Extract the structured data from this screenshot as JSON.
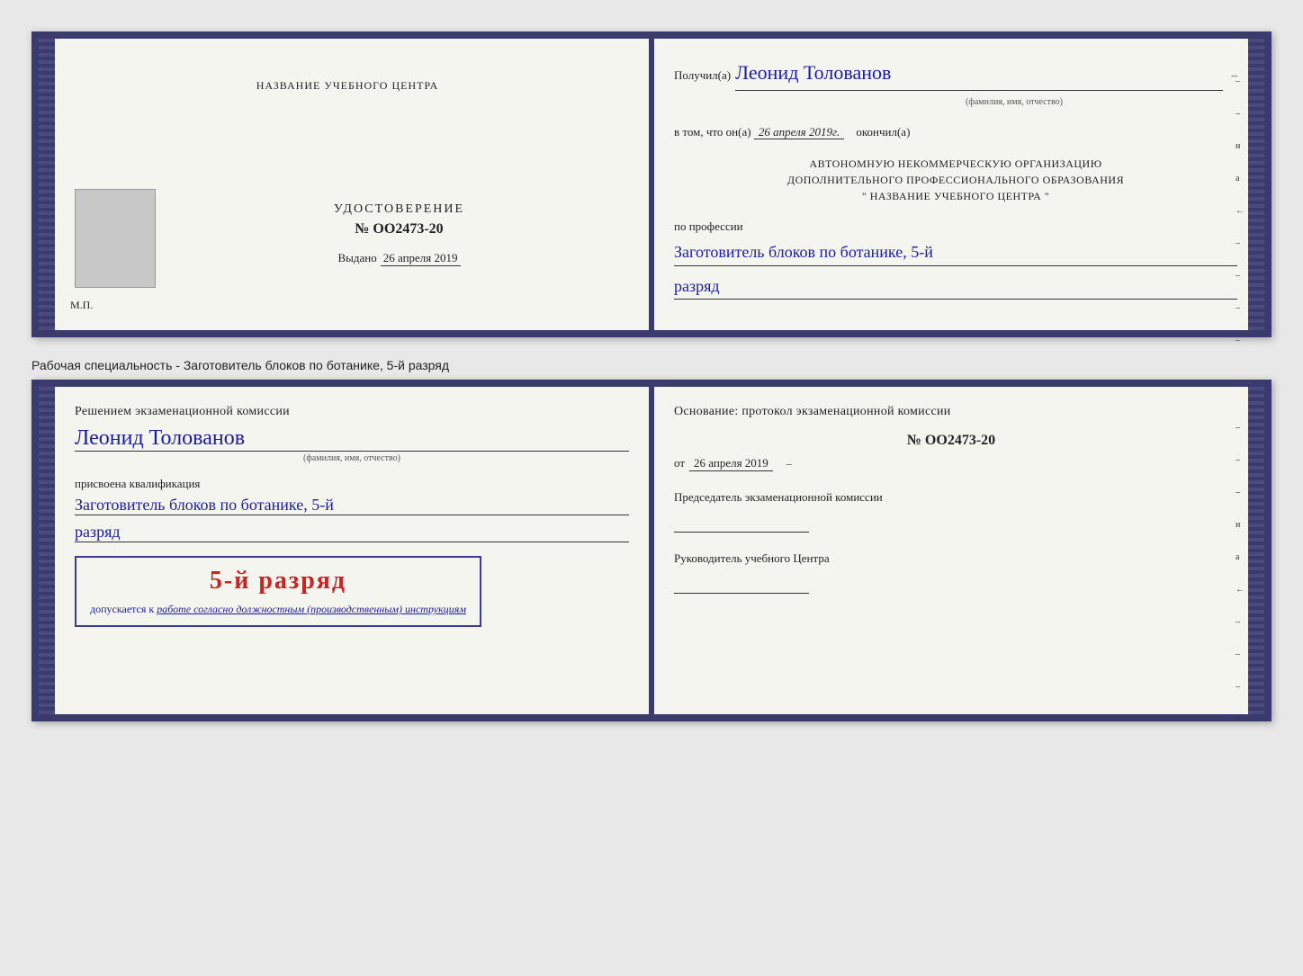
{
  "top_certificate": {
    "left": {
      "org_name": "НАЗВАНИЕ УЧЕБНОГО ЦЕНТРА",
      "cert_type": "УДОСТОВЕРЕНИЕ",
      "cert_number": "№ OO2473-20",
      "issued_label": "Выдано",
      "issued_date": "26 апреля 2019",
      "mp_label": "М.П."
    },
    "right": {
      "received_label": "Получил(а)",
      "recipient_name": "Леонид Толованов",
      "fio_label": "(фамилия, имя, отчество)",
      "date_label": "в том, что он(а)",
      "date_value": "26 апреля 2019г.",
      "finished_label": "окончил(а)",
      "org_block_line1": "АВТОНОМНУЮ НЕКОММЕРЧЕСКУЮ ОРГАНИЗАЦИЮ",
      "org_block_line2": "ДОПОЛНИТЕЛЬНОГО ПРОФЕССИОНАЛЬНОГО ОБРАЗОВАНИЯ",
      "org_block_line3": "\" НАЗВАНИЕ УЧЕБНОГО ЦЕНТРА \"",
      "profession_label": "по профессии",
      "profession_value": "Заготовитель блоков по ботанике, 5-й",
      "rank_value": "разряд",
      "side_marks": [
        "–",
        "–",
        "и",
        "а",
        "←",
        "–",
        "–",
        "–",
        "–"
      ]
    }
  },
  "specialty_label": "Рабочая специальность - Заготовитель блоков по ботанике, 5-й разряд",
  "bottom_certificate": {
    "left": {
      "decision_text": "Решением экзаменационной комиссии",
      "person_name": "Леонид Толованов",
      "fio_label": "(фамилия, имя, отчество)",
      "qualification_label": "присвоена квалификация",
      "qualification_value": "Заготовитель блоков по ботанике, 5-й",
      "rank_value": "разряд",
      "seal_rank": "5-й разряд",
      "allowed_text": "допускается к",
      "allowed_italic": "работе согласно должностным (производственным) инструкциям"
    },
    "right": {
      "basis_title": "Основание: протокол экзаменационной комиссии",
      "protocol_number": "№  OO2473-20",
      "date_prefix": "от",
      "date_value": "26 апреля 2019",
      "chairman_label": "Председатель экзаменационной комиссии",
      "director_label": "Руководитель учебного Центра",
      "side_marks": [
        "–",
        "–",
        "–",
        "и",
        "а",
        "←",
        "–",
        "–",
        "–",
        "–"
      ]
    }
  }
}
